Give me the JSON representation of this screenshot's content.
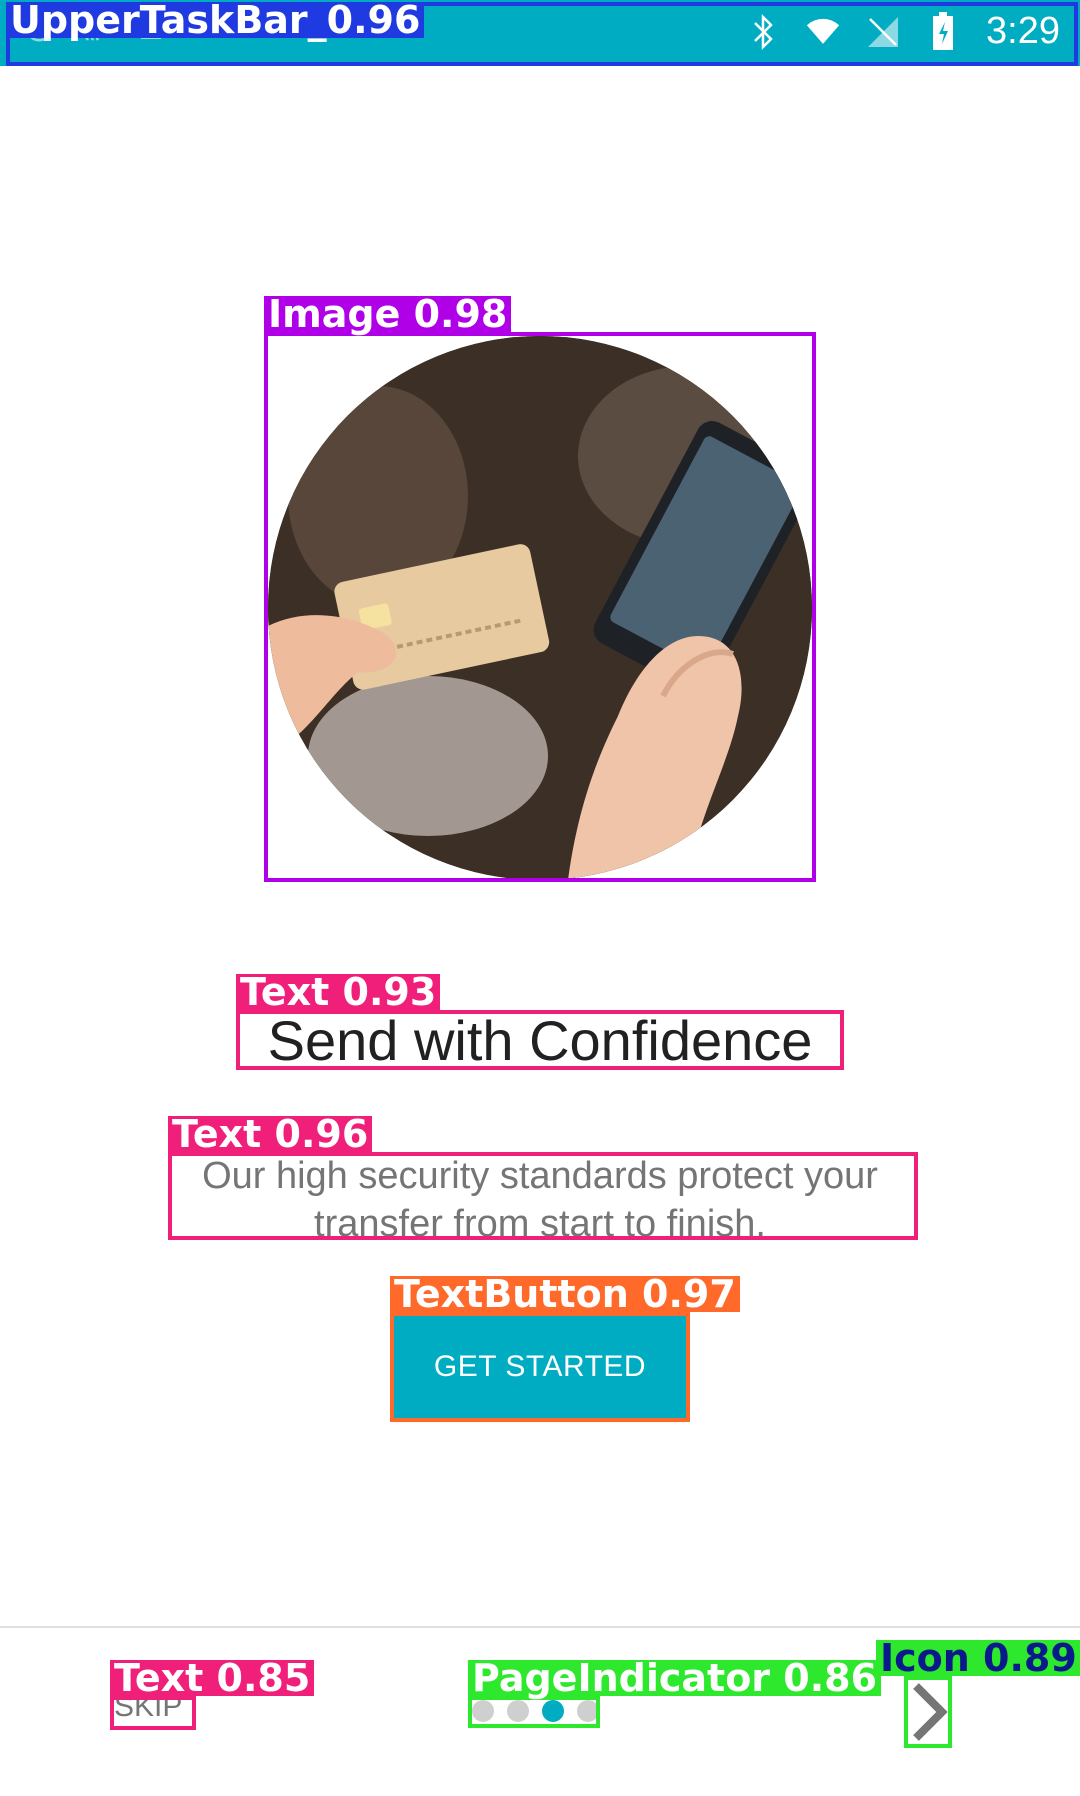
{
  "status_bar": {
    "time": "3:29",
    "icons": [
      "notification-icon",
      "cast-icon",
      "download-icon",
      "sim-icon",
      "bluetooth-icon",
      "wifi-icon",
      "no-signal-icon",
      "battery-charging-icon"
    ]
  },
  "hero": {
    "image": "phone-and-credit-card-photo"
  },
  "onboarding": {
    "title": "Send with Confidence",
    "description": "Our high security standards protect your transfer from start to finish.",
    "cta_label": "GET STARTED"
  },
  "bottom_nav": {
    "skip_label": "SKIP",
    "page_indicator": {
      "total": 4,
      "current": 3
    },
    "next_icon": "chevron-right-icon"
  },
  "annotations": {
    "upper_task_bar": "UpperTaskBar_0.96",
    "image": "Image  0.98",
    "title_text": "Text  0.93",
    "body_text": "Text  0.96",
    "text_button": "TextButton  0.97",
    "skip_text": "Text  0.85",
    "page_indicator": "PageIndicator  0.86",
    "icon": "Icon  0.89"
  },
  "colors": {
    "accent": "#00acc1",
    "title": "#212121",
    "body": "#757575",
    "anno_blue": "#1f3ae0",
    "anno_purple": "#b000e8",
    "anno_pink": "#f0207a",
    "anno_orange": "#ff6a2a",
    "anno_green": "#2ee82e"
  }
}
